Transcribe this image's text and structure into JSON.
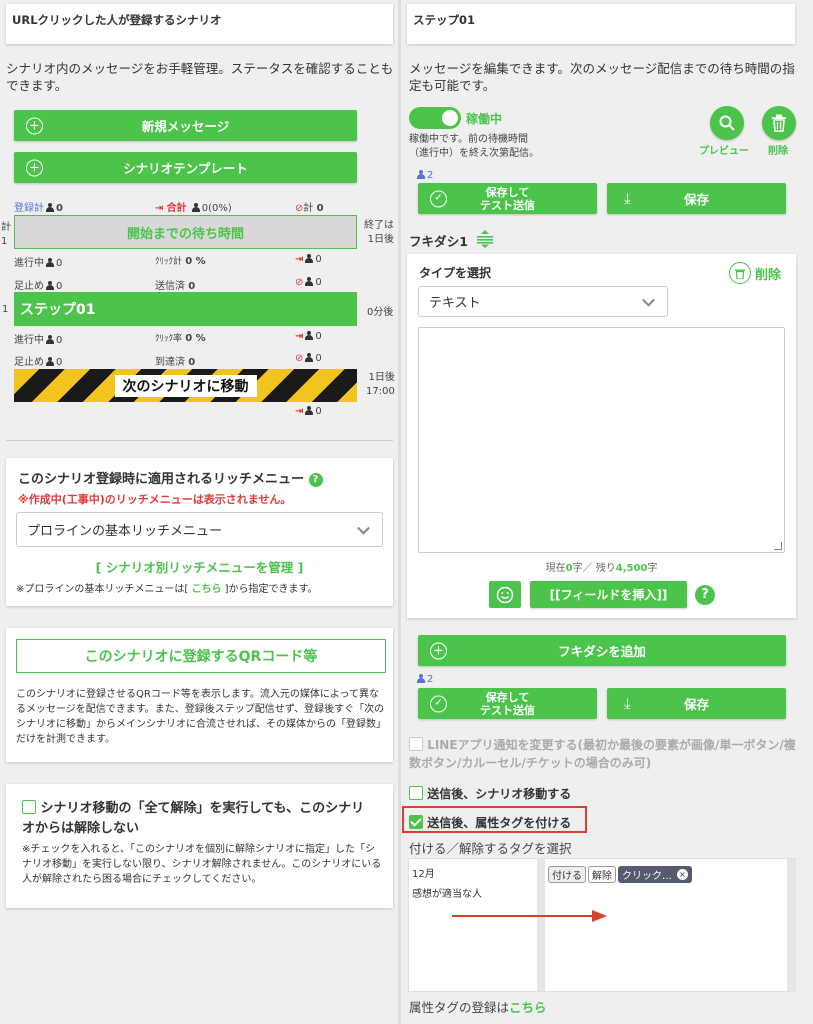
{
  "left": {
    "header_title": "URLクリックした人が登録するシナリオ",
    "description": "シナリオ内のメッセージをお手軽管理。ステータスを確認することもできます。",
    "new_message_btn": "新規メッセージ",
    "template_btn": "シナリオテンプレート",
    "stats_top": {
      "reg_label": "登録計",
      "reg_val": "0",
      "total_label": "合計",
      "total_val": "0(0%)",
      "stop_label": "計",
      "stop_val": "0"
    },
    "wait_left": "計\n1",
    "wait_bar": "開始までの待ち時間",
    "wait_right": "終了は\n1日後",
    "row1": {
      "progress_label": "進行中",
      "progress_val": "0",
      "click_label": "ｸﾘｯｸ計",
      "click_val": "0 %",
      "exit_val": "0"
    },
    "row2": {
      "stop_label": "足止め",
      "stop_val": "0",
      "sent_label": "送信済",
      "sent_val": "0",
      "ban_val": "0"
    },
    "step_num": "1",
    "step_bar": "ステップ01",
    "step_right": "0分後",
    "row3": {
      "progress_label": "進行中",
      "progress_val": "0",
      "click_label": "ｸﾘｯｸ率",
      "click_val": "0 %",
      "exit_val": "0"
    },
    "row4": {
      "stop_label": "足止め",
      "stop_val": "0",
      "reach_label": "到達済",
      "reach_val": "0",
      "ban_val": "0"
    },
    "next_bar": "次のシナリオに移動",
    "next_right": "1日後\n17:00",
    "row5_exit_val": "0",
    "rich_title": "このシナリオ登録時に適用されるリッチメニュー",
    "rich_warning": "※作成中(工事中)のリッチメニューは表示されません。",
    "rich_select": "プロラインの基本リッチメニュー",
    "rich_manage_link": "[ シナリオ別リッチメニューを管理 ]",
    "rich_note_pre": "※プロラインの基本リッチメニューは[ ",
    "rich_note_link": "こちら",
    "rich_note_post": " ]から指定できます。",
    "qr_btn": "このシナリオに登録するQRコード等",
    "qr_desc": "このシナリオに登録させるQRコード等を表示します。流入元の媒体によって異なるメッセージを配信できます。また、登録後ステップ配信せず、登録後すぐ「次のシナリオに移動」からメインシナリオに合流させれば、その媒体からの「登録数」だけを計測できます。",
    "unreg_title": "シナリオ移動の「全て解除」を実行しても、このシナリオからは解除しない",
    "unreg_note": "※チェックを入れると、「このシナリオを個別に解除シナリオに指定」した「シナリオ移動」を実行しない限り、シナリオ解除されません。このシナリオにいる人が解除されたら困る場合にチェックしてください。"
  },
  "right": {
    "header_title": "ステップ01",
    "description": "メッセージを編集できます。次のメッセージ配信までの待ち時間の指定も可能です。",
    "toggle_label": "稼働中",
    "status_note": "稼働中です。前の待機時間\n（進行中）を終え次第配信。",
    "preview_label": "プレビュー",
    "delete_label": "削除",
    "count1": "2",
    "save_test_btn": "保存して\nテスト送信",
    "save_btn": "保存",
    "fukidashi_label": "フキダシ1",
    "type_label": "タイプを選択",
    "type_delete": "削除",
    "type_select": "テキスト",
    "counter_pre": "現在",
    "counter_cur": "0",
    "counter_mid": "字／ 残り",
    "counter_rem": "4,500",
    "counter_post": "字",
    "insert_field_btn": "[[フィールドを挿入]]",
    "add_fukidashi_btn": "フキダシを追加",
    "count2": "2",
    "save_test_btn2": "保存して\nテスト送信",
    "save_btn2": "保存",
    "line_notify": "LINEアプリ通知を変更する(最初か最後の要素が画像/単一ボタン/複数ボタン/カルーセル/チケットの場合のみ可)",
    "after_send_move": "送信後、シナリオ移動する",
    "after_send_tag": "送信後、属性タグを付ける",
    "tag_select_label": "付ける／解除するタグを選択",
    "tag_list": [
      "12月",
      "感想が適当な人"
    ],
    "tag_add": "付ける",
    "tag_remove": "解除",
    "tag_chip": "クリック…",
    "tag_register_pre": "属性タグの登録は",
    "tag_register_link": "こちら"
  },
  "colors": {
    "green": "#4cc44c",
    "red": "#e03a3a",
    "highlight": "#d9412f"
  }
}
